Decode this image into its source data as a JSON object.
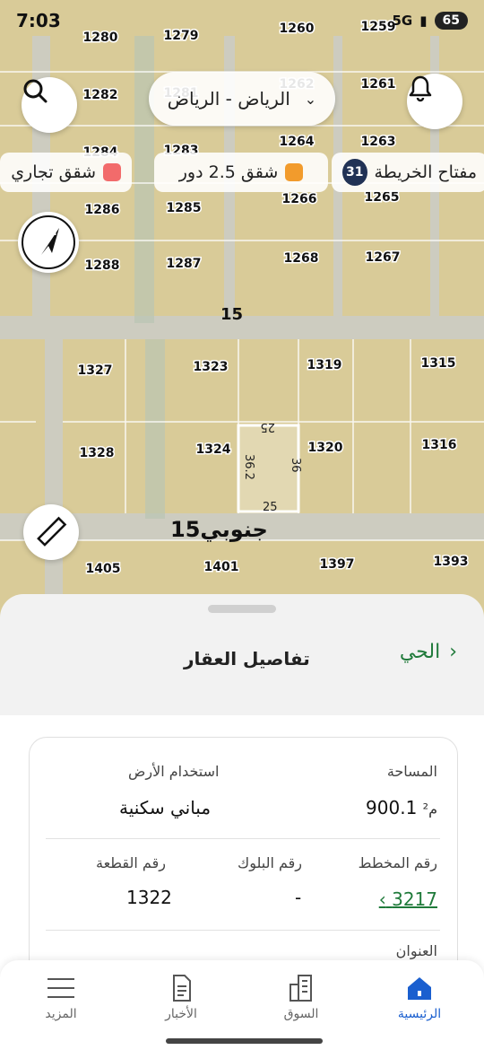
{
  "status": {
    "time": "7:03",
    "network": "5G",
    "battery": "65"
  },
  "map": {
    "region": "الرياض - الرياض",
    "legend": {
      "count": "31",
      "key_label": "مفتاح الخريطة",
      "apartments": "شقق 2.5 دور",
      "commercial": "شقق تجاري"
    },
    "compass_letter": "N",
    "street_label": "15",
    "street_bottom_label": "15جنوبي",
    "parcels": [
      "1280",
      "1279",
      "1260",
      "1259",
      "1282",
      "1281",
      "1262",
      "1261",
      "1284",
      "1283",
      "1264",
      "1263",
      "1286",
      "1285",
      "1266",
      "1265",
      "1288",
      "1287",
      "1268",
      "1267",
      "1327",
      "1323",
      "1319",
      "1315",
      "1328",
      "1324",
      "1320",
      "1316",
      "1405",
      "1401",
      "1397",
      "1393"
    ],
    "dim_top": "25",
    "dim_bottom": "25",
    "dim_left": "36.2",
    "dim_right": "36",
    "colors": {
      "parcel": "#e3d3a2",
      "road": "#cfcfc4",
      "selected": "#ffffff",
      "apartments": "#f29b2c",
      "commercial": "#f26b6b"
    }
  },
  "sheet": {
    "title": "تفاصيل العقار",
    "back_label": "الحي",
    "area_label": "المساحة",
    "area_value": "900.1",
    "area_unit": "م²",
    "land_use_label": "استخدام الأرض",
    "land_use_value": "مباني سكنية",
    "plan_label": "رقم المخطط",
    "plan_value": "3217",
    "block_label": "رقم البلوك",
    "block_value": "-",
    "plot_label": "رقم القطعة",
    "plot_value": "1322",
    "address_label": "العنوان",
    "accent": "#1f7a3a"
  },
  "nav": {
    "home": "الرئيسية",
    "market": "السوق",
    "news": "الأخبار",
    "more": "المزيد",
    "active_color": "#1a5fcf"
  }
}
